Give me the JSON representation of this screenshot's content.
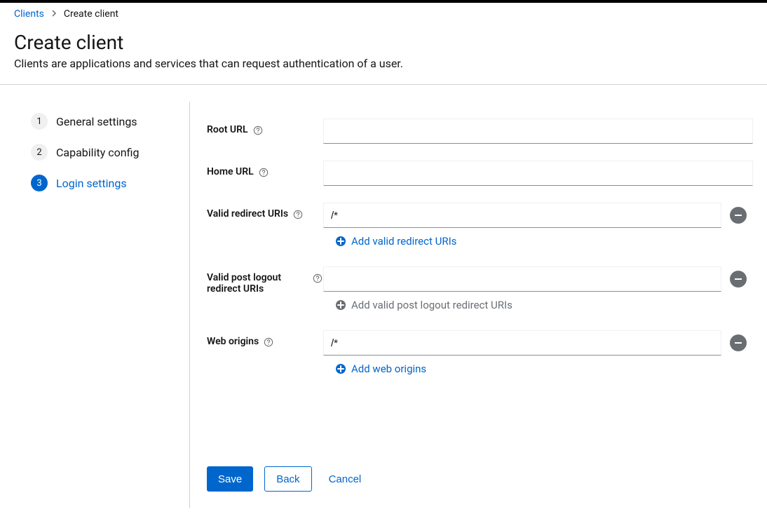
{
  "breadcrumb": {
    "parent": "Clients",
    "current": "Create client"
  },
  "header": {
    "title": "Create client",
    "description": "Clients are applications and services that can request authentication of a user."
  },
  "wizard": {
    "steps": [
      {
        "num": "1",
        "label": "General settings"
      },
      {
        "num": "2",
        "label": "Capability config"
      },
      {
        "num": "3",
        "label": "Login settings"
      }
    ]
  },
  "form": {
    "root_url": {
      "label": "Root URL",
      "value": ""
    },
    "home_url": {
      "label": "Home URL",
      "value": ""
    },
    "valid_redirect_uris": {
      "label": "Valid redirect URIs",
      "value": "/*",
      "add_label": "Add valid redirect URIs"
    },
    "valid_post_logout_redirect_uris": {
      "label": "Valid post logout redirect URIs",
      "value": "",
      "add_label": "Add valid post logout redirect URIs"
    },
    "web_origins": {
      "label": "Web origins",
      "value": "/*",
      "add_label": "Add web origins"
    }
  },
  "actions": {
    "save": "Save",
    "back": "Back",
    "cancel": "Cancel"
  }
}
